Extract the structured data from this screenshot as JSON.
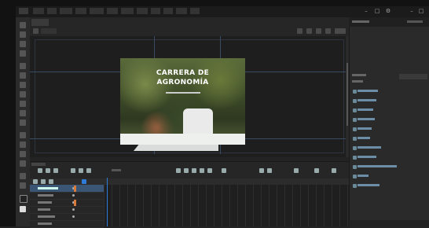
{
  "hero": {
    "title_line1": "CARRERA DE",
    "title_line2": "AGRONOMÍA"
  },
  "colors": {
    "selection": "#3b5675",
    "playhead": "#2f7bd8",
    "panel_bg": "#2a2a2a",
    "stage_bg": "#1e1e1e"
  },
  "icons": [
    "close-icon",
    "minimize-icon",
    "maximize-icon",
    "play-icon",
    "eye-icon",
    "lock-icon"
  ]
}
